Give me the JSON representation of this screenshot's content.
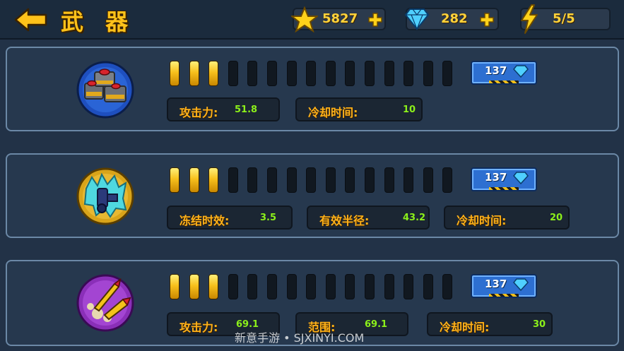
{
  "header": {
    "title": "武 器",
    "stars": "5827",
    "gems": "282",
    "energy": "5/5"
  },
  "weapons": [
    {
      "level": 3,
      "max_level": 15,
      "upgrade_cost": "137",
      "stats": [
        {
          "label": "攻击力:",
          "value": "51.8"
        },
        {
          "label": "冷却时间:",
          "value": "10"
        }
      ]
    },
    {
      "level": 3,
      "max_level": 15,
      "upgrade_cost": "137",
      "stats": [
        {
          "label": "冻结时效:",
          "value": "3.5"
        },
        {
          "label": "有效半径:",
          "value": "43.2"
        },
        {
          "label": "冷却时间:",
          "value": "20"
        }
      ]
    },
    {
      "level": 3,
      "max_level": 15,
      "upgrade_cost": "137",
      "stats": [
        {
          "label": "攻击力:",
          "value": "69.1"
        },
        {
          "label": "范围:",
          "value": "69.1"
        },
        {
          "label": "冷却时间:",
          "value": "30"
        }
      ]
    }
  ],
  "watermark": "新意手游 • SJXINYI.COM",
  "colors": {
    "accent": "#ffc21a",
    "stat_value": "#8cf01a",
    "card_border": "#6b88a6",
    "upgrade_button": "#2d6fd1"
  },
  "icons": {
    "back": "back-arrow-icon",
    "star": "star-icon",
    "gem": "diamond-icon",
    "energy": "lightning-icon",
    "plus": "plus-icon",
    "weapon_1": "mine-turret-icon",
    "weapon_2": "ice-cannon-icon",
    "weapon_3": "missile-icon"
  }
}
